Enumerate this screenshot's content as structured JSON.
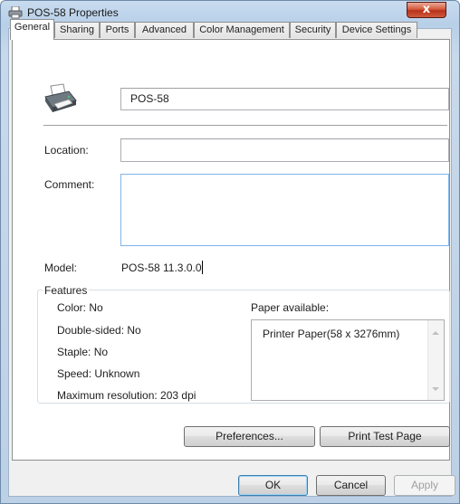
{
  "window": {
    "title": "POS-58 Properties",
    "close_glyph": "x"
  },
  "tabs": [
    "General",
    "Sharing",
    "Ports",
    "Advanced",
    "Color Management",
    "Security",
    "Device Settings"
  ],
  "active_tab": "General",
  "printer_name": "POS-58",
  "location": {
    "label": "Location:",
    "value": ""
  },
  "comment": {
    "label": "Comment:",
    "value": ""
  },
  "model": {
    "label": "Model:",
    "value": "POS-58 11.3.0.0"
  },
  "features": {
    "title": "Features",
    "color": "Color: No",
    "double_sided": "Double-sided: No",
    "staple": "Staple: No",
    "speed": "Speed: Unknown",
    "max_resolution": "Maximum resolution: 203 dpi",
    "paper_label": "Paper available:",
    "paper_items": [
      "Printer Paper(58 x 3276mm)"
    ]
  },
  "buttons": {
    "preferences": "Preferences...",
    "print_test": "Print Test Page",
    "ok": "OK",
    "cancel": "Cancel",
    "apply": "Apply"
  },
  "icons": {
    "title": "printer-icon",
    "printer": "printer-icon"
  },
  "colors": {
    "accent": "#3c7fb1",
    "close": "#c9462c"
  }
}
